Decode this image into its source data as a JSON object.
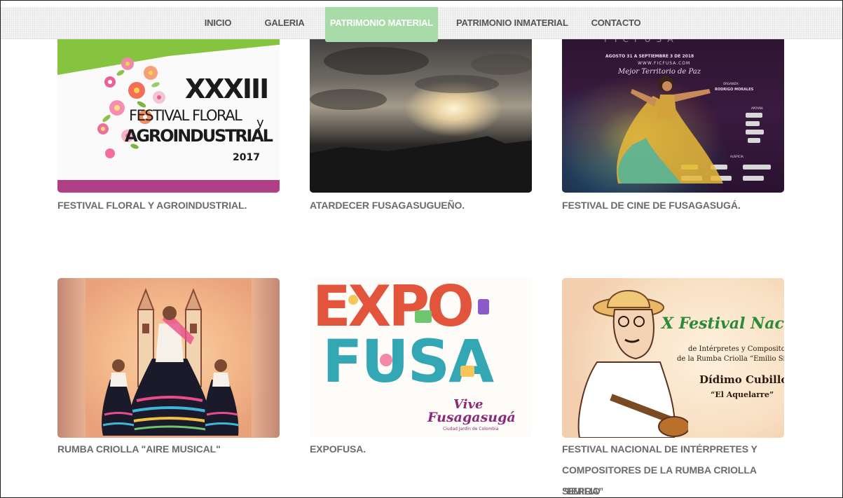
{
  "nav": {
    "items": [
      {
        "label": "INICIO",
        "active": false
      },
      {
        "label": "GALERIA",
        "active": false
      },
      {
        "label": "PATRIMONIO MATERIAL",
        "active": true
      },
      {
        "label": "PATRIMONIO INMATERIAL",
        "active": false
      },
      {
        "label": "CONTACTO",
        "active": false
      }
    ],
    "active_color": "#a9dba9"
  },
  "gallery": {
    "items": [
      {
        "caption": "FESTIVAL FLORAL Y AGROINDUSTRIAL.",
        "image_text": {
          "line1": "XXXIII",
          "line2": "FESTIVAL FLORAL",
          "line2b": "y",
          "line3": "AGROINDUSTRIAL",
          "year": "2017"
        }
      },
      {
        "caption": "ATARDECER FUSAGASUGUEÑO."
      },
      {
        "caption": "FESTIVAL DE CINE DE FUSAGASUGÁ.",
        "image_text": {
          "brand": "FICFUSA",
          "dates": "AGOSTO 31 A SEPTIEMBRE 3 DE 2018",
          "site": "WWW.FICFUSA.COM",
          "slogan": "Mejor Territorio de Paz",
          "org_label": "ORGANIZA:",
          "org": "RODRIGO MORALES",
          "support_label": "APOYAN:",
          "sponsor_label": "AUSPICIA:"
        }
      },
      {
        "caption": "RUMBA CRIOLLA \"AIRE MUSICAL\""
      },
      {
        "caption": "EXPOFUSA.",
        "image_text": {
          "word1": "EXPO",
          "word2": "FUSA",
          "script1": "Vive",
          "script2": "Fusagasugá",
          "tagline": "Ciudad Jardín de Colombia"
        }
      },
      {
        "caption_lines": [
          "FESTIVAL NACIONAL DE INTÉRPRETES Y",
          "COMPOSITORES DE LA RUMBA CRIOLLA “EMILIO",
          "SIERRA”"
        ],
        "image_text": {
          "title1": "X Festival Nacional",
          "sub1": "de Intérpretes y Compositores",
          "sub2": "de la Rumba Criolla “Emilio Sierra”",
          "name": "Dídimo Cubillos",
          "alias": "“El Aquelarre”"
        }
      }
    ]
  }
}
